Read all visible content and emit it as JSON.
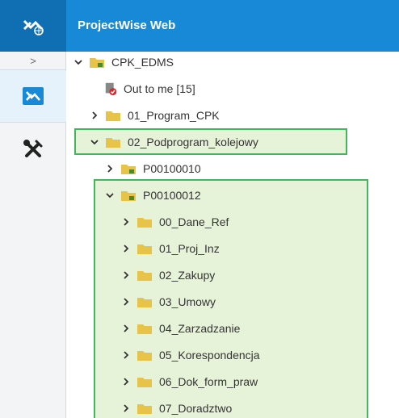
{
  "app": {
    "title": "ProjectWise Web"
  },
  "rail": {
    "expand_glyph": ">"
  },
  "tree": {
    "root": "CPK_EDMS",
    "out_to_me": "Out to me [15]",
    "program": "01_Program_CPK",
    "subprogram": "02_Podprogram_kolejowy",
    "p1": "P00100010",
    "p2": "P00100012",
    "children": [
      "00_Dane_Ref",
      "01_Proj_Inz",
      "02_Zakupy",
      "03_Umowy",
      "04_Zarzadzanie",
      "05_Korespondencja",
      "06_Dok_form_praw",
      "07_Doradztwo"
    ]
  },
  "colors": {
    "header": "#1789d6",
    "logo_bg": "#0f6fb2",
    "highlight_border": "#3fb75a",
    "folder": "#e8c349"
  }
}
